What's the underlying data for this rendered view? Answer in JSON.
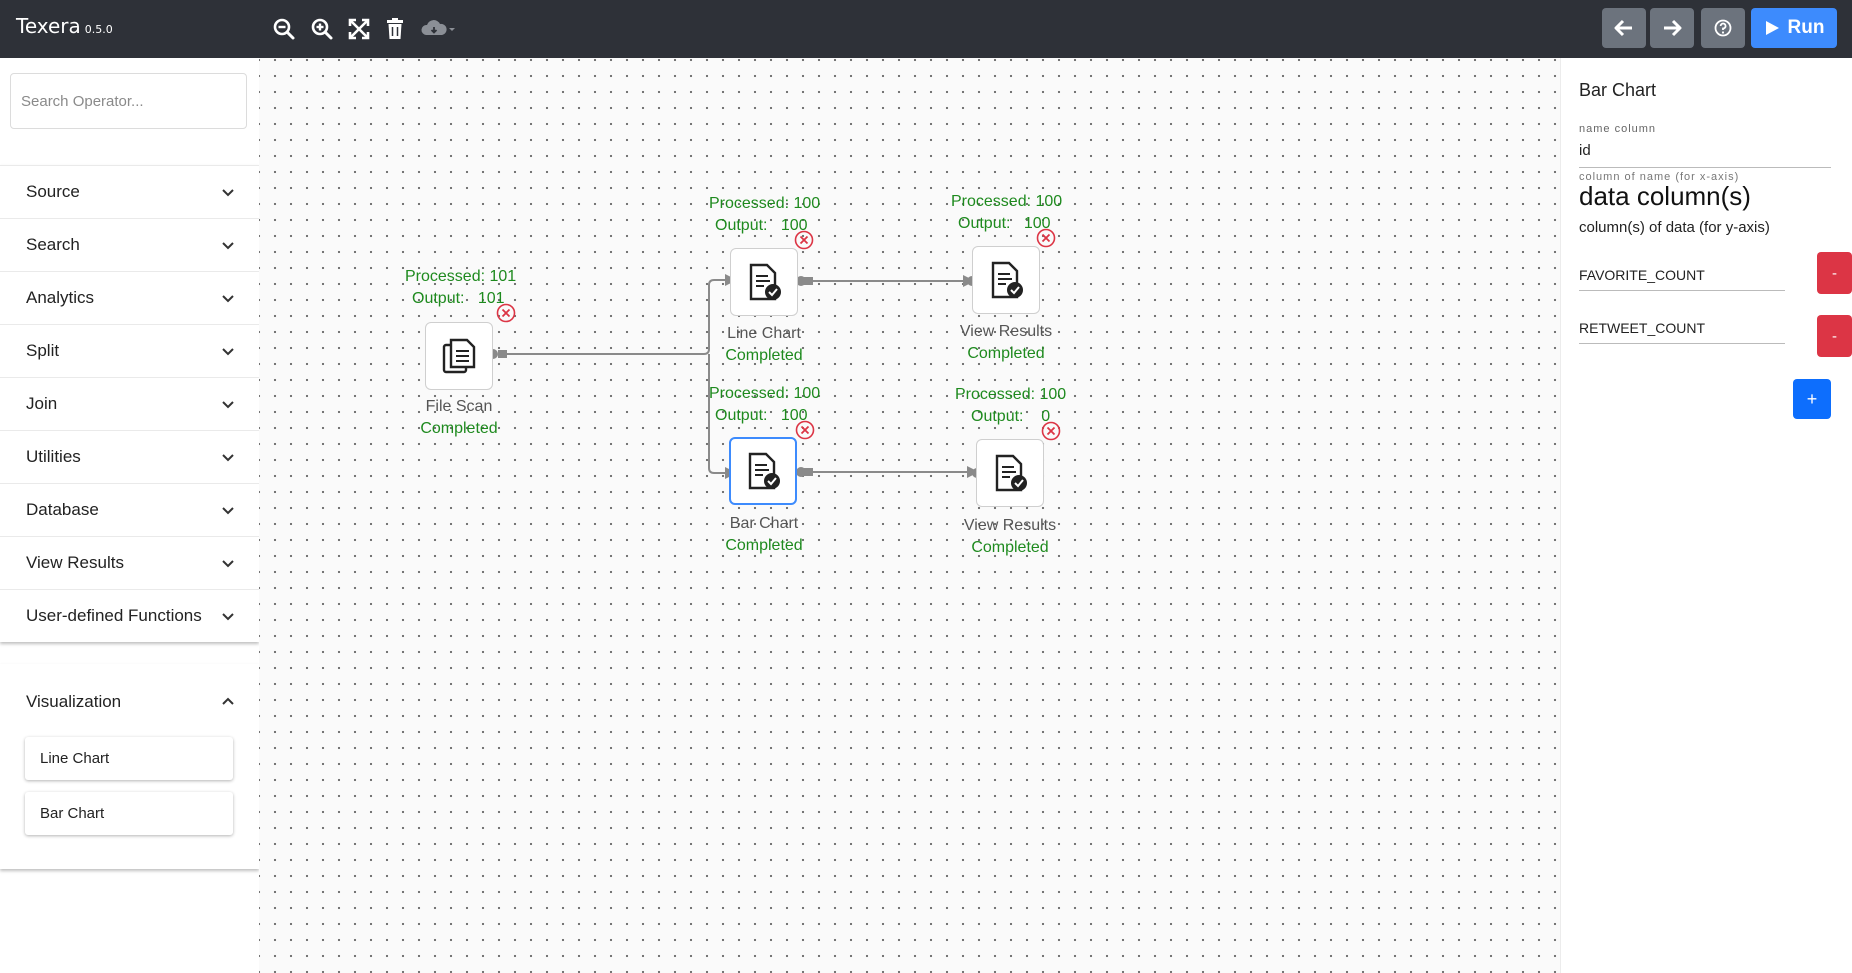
{
  "app": {
    "name": "Texera",
    "version": "0.5.0"
  },
  "toolbar": {
    "tools": [
      "zoom-out-icon",
      "zoom-in-icon",
      "fit-screen-icon",
      "delete-icon",
      "cloud-download-icon"
    ],
    "undo_icon": "arrow-left-icon",
    "redo_icon": "arrow-right-icon",
    "help_icon": "help-icon",
    "run_label": "Run"
  },
  "sidebar": {
    "search_placeholder": "Search Operator...",
    "categories": [
      "Source",
      "Search",
      "Analytics",
      "Split",
      "Join",
      "Utilities",
      "Database",
      "View Results",
      "User-defined Functions"
    ],
    "visualization": {
      "label": "Visualization",
      "items": [
        "Line Chart",
        "Bar Chart"
      ]
    }
  },
  "workflow": {
    "operators": [
      {
        "label": "File Scan",
        "status": "Completed",
        "processed": "Processed: 101",
        "output": "Output:   101"
      },
      {
        "label": "Line Chart",
        "status": "Completed",
        "processed": "Processed: 100",
        "output": "Output:   100"
      },
      {
        "label": "View Results",
        "status": "Completed",
        "processed": "Processed: 100",
        "output": "Output:   100"
      },
      {
        "label": "Bar Chart",
        "status": "Completed",
        "processed": "Processed: 100",
        "output": "Output:   100"
      },
      {
        "label": "View Results",
        "status": "Completed",
        "processed": "Processed: 100",
        "output": "Output:    0"
      }
    ]
  },
  "properties": {
    "title": "Bar Chart",
    "name_column_label": "name column",
    "name_column_value": "id",
    "name_column_hint": "column of name (for x-axis)",
    "data_columns_title": "data column(s)",
    "data_columns_sub": "column(s) of data (for y-axis)",
    "data_columns": [
      "FAVORITE_COUNT",
      "RETWEET_COUNT"
    ],
    "remove_label": "-",
    "add_label": "+"
  },
  "colors": {
    "topbar": "#2e3138",
    "run": "#3d8bfd",
    "status_green": "#1e8a1e",
    "remove": "#dc3545",
    "add": "#0d6efd",
    "error_icon": "#dc3545"
  }
}
